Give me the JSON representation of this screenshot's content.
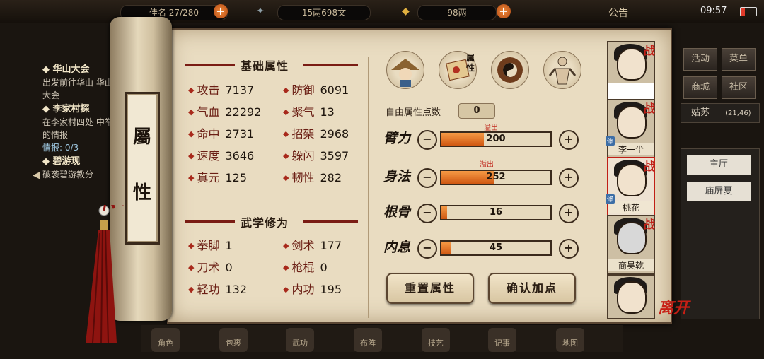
{
  "top": {
    "res1": "佳名 27/280",
    "money": "15两698文",
    "gold": "98两",
    "notice": "公告",
    "time": "09:57"
  },
  "quests": [
    {
      "title": "华山大会",
      "desc": "出发前往华山 华山大会"
    },
    {
      "title": "李家村探",
      "desc": "在李家村四处 中举的情报",
      "progress": "情报: 0/3"
    },
    {
      "title": "碧游现",
      "desc": "破袭碧游教分"
    }
  ],
  "scroll_label": [
    "屬",
    "性"
  ],
  "basic": {
    "title": "基础属性",
    "stats": [
      {
        "name": "攻击",
        "value": "7137"
      },
      {
        "name": "防御",
        "value": "6091"
      },
      {
        "name": "气血",
        "value": "22292"
      },
      {
        "name": "聚气",
        "value": "13"
      },
      {
        "name": "命中",
        "value": "2731"
      },
      {
        "name": "招架",
        "value": "2968"
      },
      {
        "name": "速度",
        "value": "3646"
      },
      {
        "name": "躲闪",
        "value": "3597"
      },
      {
        "name": "真元",
        "value": "125"
      },
      {
        "name": "韧性",
        "value": "282"
      }
    ]
  },
  "martial": {
    "title": "武学修为",
    "stats": [
      {
        "name": "拳脚",
        "value": "1"
      },
      {
        "name": "剑术",
        "value": "177"
      },
      {
        "name": "刀术",
        "value": "0"
      },
      {
        "name": "枪棍",
        "value": "0"
      },
      {
        "name": "轻功",
        "value": "132"
      },
      {
        "name": "内功",
        "value": "195"
      }
    ]
  },
  "tabs": {
    "attr_tab_label": "属性"
  },
  "free_points": {
    "label": "自由属性点数",
    "value": "0"
  },
  "attributes": [
    {
      "name": "臂力",
      "value": "200",
      "fill": 0.39,
      "overflow": "溢出"
    },
    {
      "name": "身法",
      "value": "252",
      "fill": 0.49,
      "overflow": "溢出"
    },
    {
      "name": "根骨",
      "value": "16",
      "fill": 0.05,
      "overflow": ""
    },
    {
      "name": "内息",
      "value": "45",
      "fill": 0.09,
      "overflow": ""
    }
  ],
  "buttons": {
    "reset": "重置属性",
    "confirm": "确认加点"
  },
  "party": [
    {
      "name": "",
      "zhan": "战",
      "xiu": ""
    },
    {
      "name": "李一尘",
      "zhan": "战",
      "xiu": "修"
    },
    {
      "name": "桃花",
      "zhan": "战",
      "xiu": "修"
    },
    {
      "name": "商昊乾",
      "zhan": "战",
      "xiu": ""
    },
    {
      "name": "",
      "zhan": "",
      "xiu": ""
    }
  ],
  "right_menu": {
    "huodong": "活动",
    "caidan": "菜单",
    "shangcheng": "商城",
    "shequ": "社区",
    "location": "姑苏",
    "coords": "(21,46)",
    "main_hall": "主厅",
    "corridor": "庙屏夏"
  },
  "leave": "离开",
  "bottom": [
    "角色",
    "包裹",
    "武功",
    "布阵",
    "技艺",
    "记事",
    "地图"
  ]
}
